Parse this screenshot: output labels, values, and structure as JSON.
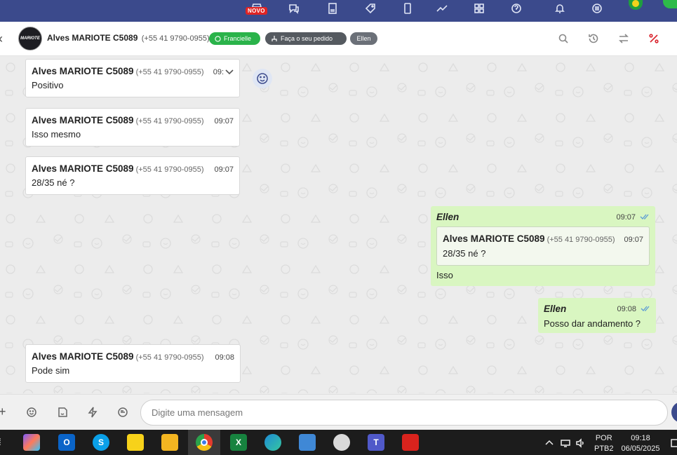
{
  "topnav": {
    "new_badge": "NOVO",
    "icons": [
      "store-icon",
      "chat-bubbles-icon",
      "document-icon",
      "tag-icon",
      "phone-icon",
      "trend-chart-icon",
      "grid-icon",
      "help-icon",
      "bell-icon",
      "menu-icon",
      "flag-brazil-icon",
      "profile-icon"
    ]
  },
  "header": {
    "contact_name": "Alves MARIOTE C5089",
    "contact_phone": "(+55 41 9790-0955)",
    "avatar_text": "MARIOTE",
    "tags": [
      {
        "label": "Francielle",
        "icon": "whatsapp-icon",
        "color": "#2ab34a"
      },
      {
        "label": "Faça o seu pedido",
        "icon": "org-chart-icon",
        "color": "#555a60"
      },
      {
        "label": "Ellen",
        "color": "#6b7078"
      }
    ],
    "actions": [
      "search-icon",
      "history-icon",
      "transfer-icon",
      "percent-icon"
    ]
  },
  "messages": [
    {
      "sender": "Alves MARIOTE C5089",
      "phone": "(+55 41 9790-0955)",
      "time": "09:",
      "text": "Positivo"
    },
    {
      "sender": "Alves MARIOTE C5089",
      "phone": "(+55 41 9790-0955)",
      "time": "09:07",
      "text": "Isso mesmo"
    },
    {
      "sender": "Alves MARIOTE C5089",
      "phone": "(+55 41 9790-0955)",
      "time": "09:07",
      "text": "28/35 né ?"
    },
    {
      "sender": "Ellen",
      "time": "09:07",
      "quote": {
        "sender": "Alves MARIOTE C5089",
        "phone": "(+55 41 9790-0955)",
        "time": "09:07",
        "text": "28/35 né ?"
      },
      "text": "Isso"
    },
    {
      "sender": "Ellen",
      "time": "09:08",
      "text": "Posso dar andamento ?"
    },
    {
      "sender": "Alves MARIOTE C5089",
      "phone": "(+55 41 9790-0955)",
      "time": "09:08",
      "text": "Pode sim"
    }
  ],
  "composer": {
    "placeholder": "Digite uma mensagem",
    "icons": [
      "plus-icon",
      "emoji-icon",
      "sticker-icon",
      "lightning-icon",
      "quick-reply-icon"
    ]
  },
  "taskbar": {
    "apps": [
      {
        "name": "copilot-icon",
        "color": "#7b5cff"
      },
      {
        "name": "outlook-icon",
        "label": "O",
        "color": "#0a64c8"
      },
      {
        "name": "skype-icon",
        "label": "S",
        "color": "#0aa0e8"
      },
      {
        "name": "sticky-notes-icon",
        "color": "#f7d21a"
      },
      {
        "name": "file-explorer-icon",
        "color": "#f3b521"
      },
      {
        "name": "chrome-icon",
        "color": "#e33b2e"
      },
      {
        "name": "excel-icon",
        "label": "X",
        "color": "#17833f"
      },
      {
        "name": "edge-icon",
        "color": "#1e8bd6"
      },
      {
        "name": "control-panel-icon",
        "color": "#3f88d6"
      },
      {
        "name": "paint-icon",
        "color": "#d9d9d9"
      },
      {
        "name": "teams-icon",
        "label": "T",
        "color": "#5059c9"
      },
      {
        "name": "acrobat-icon",
        "color": "#d9231d"
      }
    ],
    "lang_top": "POR",
    "lang_bottom": "PTB2",
    "time": "09:18",
    "date": "06/05/2025"
  }
}
